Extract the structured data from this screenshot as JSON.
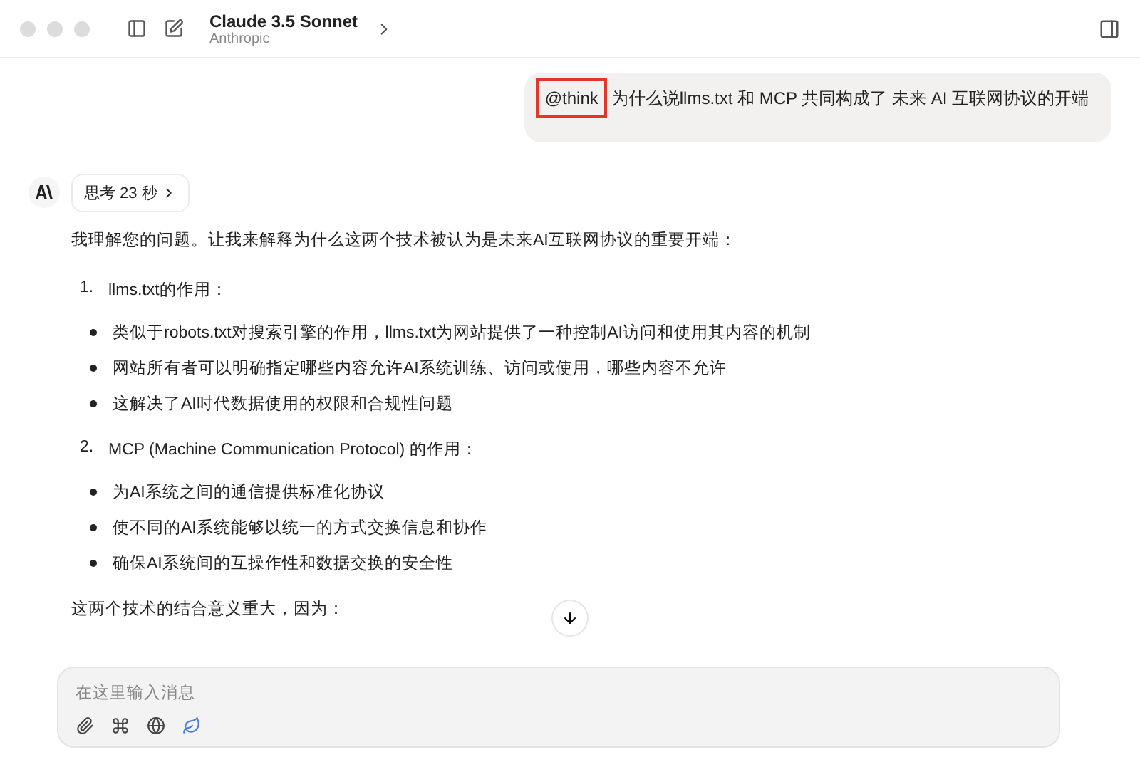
{
  "window": {
    "title": "Claude 3.5 Sonnet",
    "subtitle": "Anthropic"
  },
  "user_message": {
    "mention": "@think",
    "mention_highlighted": true,
    "text": "为什么说llms.txt 和 MCP 共同构成了 未来 AI 互联网协议的开端"
  },
  "assistant": {
    "thinking": "思考 23 秒",
    "blocks": [
      {
        "kind": "paragraph",
        "text": "我理解您的问题。让我来解释为什么这两个技术被认为是未来AI互联网协议的重要开端："
      },
      {
        "kind": "numbered",
        "number": "1.",
        "text": "llms.txt的作用："
      },
      {
        "kind": "bullet",
        "text": "类似于robots.txt对搜索引擎的作用，llms.txt为网站提供了一种控制AI访问和使用其内容的机制"
      },
      {
        "kind": "bullet",
        "text": "网站所有者可以明确指定哪些内容允许AI系统训练、访问或使用，哪些内容不允许"
      },
      {
        "kind": "bullet",
        "text": "这解决了AI时代数据使用的权限和合规性问题"
      },
      {
        "kind": "numbered",
        "number": "2.",
        "text": "MCP (Machine Communication Protocol) 的作用："
      },
      {
        "kind": "bullet",
        "text": "为AI系统之间的通信提供标准化协议"
      },
      {
        "kind": "bullet",
        "text": "使不同的AI系统能够以统一的方式交换信息和协作"
      },
      {
        "kind": "bullet",
        "text": "确保AI系统间的互操作性和数据交换的安全性"
      },
      {
        "kind": "paragraph",
        "text": "这两个技术的结合意义重大，因为："
      }
    ]
  },
  "composer": {
    "placeholder": "在这里输入消息",
    "tools": [
      {
        "kind": "attach",
        "selected": false
      },
      {
        "kind": "command",
        "selected": false
      },
      {
        "kind": "web",
        "selected": false
      },
      {
        "kind": "leaf",
        "selected": true
      }
    ]
  }
}
